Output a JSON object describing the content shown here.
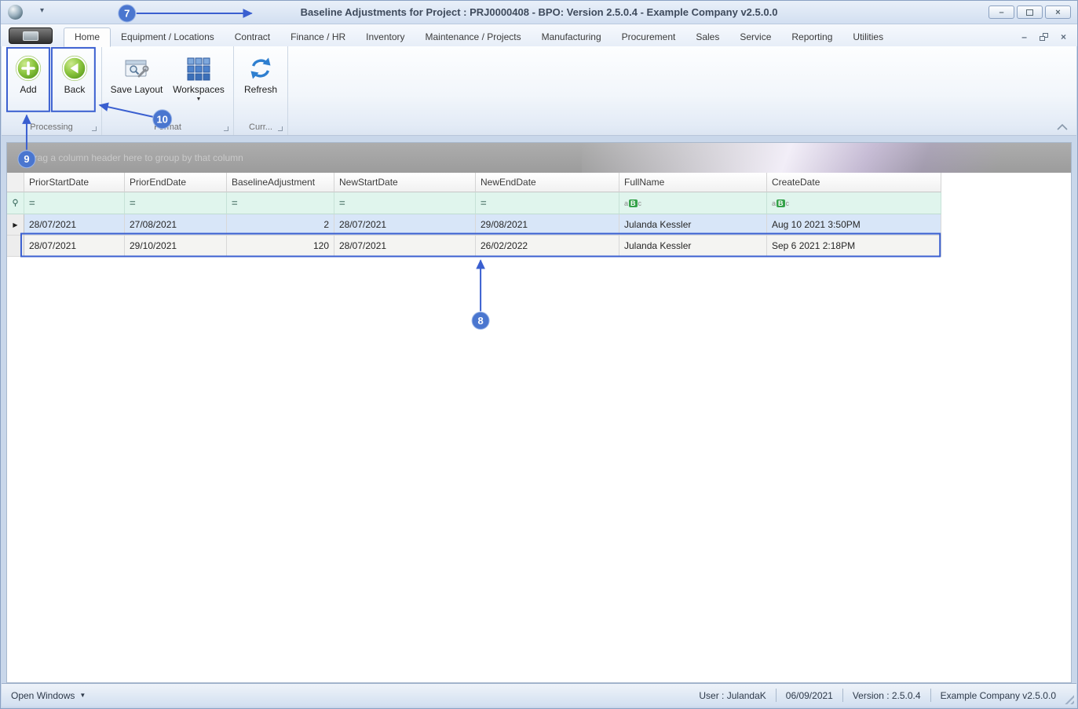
{
  "colors": {
    "annotation": "#3a5fd0",
    "callout_fill": "#4a76cf",
    "selection_row": "#d8e6f8",
    "filter_row": "#e0f5ed"
  },
  "titlebar": {
    "title": "Baseline Adjustments for Project : PRJ0000408 - BPO: Version 2.5.0.4 - Example Company v2.5.0.0"
  },
  "icons": {
    "minimize": "–",
    "close": "×",
    "qat_caret": "▾",
    "dropdown_caret": "▼",
    "row_arrow": "▶",
    "open_windows_caret": "▼"
  },
  "ribbon": {
    "tabs": [
      "Home",
      "Equipment / Locations",
      "Contract",
      "Finance / HR",
      "Inventory",
      "Maintenance / Projects",
      "Manufacturing",
      "Procurement",
      "Sales",
      "Service",
      "Reporting",
      "Utilities"
    ],
    "active_tab": "Home",
    "buttons": {
      "add": "Add",
      "back": "Back",
      "save_layout": "Save Layout",
      "workspaces": "Workspaces",
      "refresh": "Refresh"
    },
    "groups": {
      "processing": "Processing",
      "format": "Format",
      "current": "Curr..."
    }
  },
  "grid": {
    "group_panel": "Drag a column header here to group by that column",
    "columns": [
      "PriorStartDate",
      "PriorEndDate",
      "BaselineAdjustment",
      "NewStartDate",
      "NewEndDate",
      "FullName",
      "CreateDate"
    ],
    "filter": {
      "eq": "=",
      "a": "a",
      "b": "B",
      "c": "c"
    },
    "rows": [
      {
        "cells": [
          "28/07/2021",
          "27/08/2021",
          "2",
          "28/07/2021",
          "29/08/2021",
          "Julanda Kessler",
          "Aug 10 2021  3:50PM"
        ],
        "selected": true
      },
      {
        "cells": [
          "28/07/2021",
          "29/10/2021",
          "120",
          "28/07/2021",
          "26/02/2022",
          "Julanda Kessler",
          "Sep  6 2021  2:18PM"
        ],
        "selected": false
      }
    ]
  },
  "statusbar": {
    "open_windows": "Open Windows",
    "user": "User : JulandaK",
    "date": "06/09/2021",
    "version": "Version : 2.5.0.4",
    "company": "Example Company v2.5.0.0"
  },
  "annotations": {
    "c7": "7",
    "c8": "8",
    "c9": "9",
    "c10": "10"
  }
}
